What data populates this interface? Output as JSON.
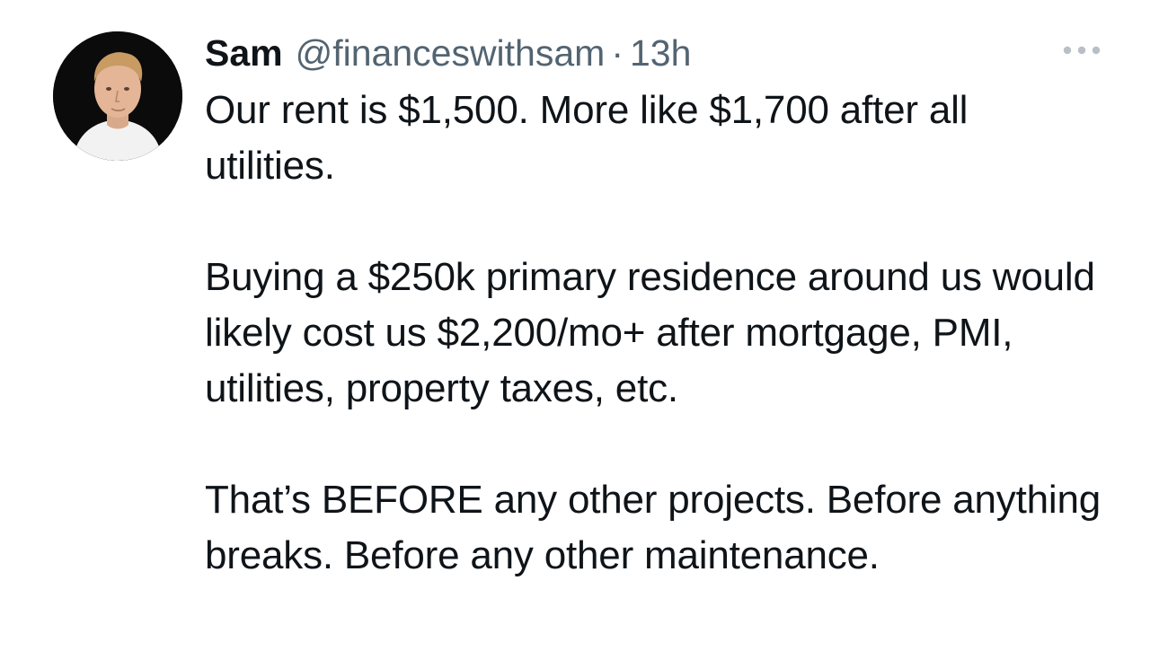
{
  "tweet": {
    "author": {
      "display_name": "Sam",
      "handle": "@financeswithsam",
      "avatar_icon": "profile-photo"
    },
    "separator": "·",
    "timestamp": "13h",
    "more_icon": "more-options-icon",
    "paragraphs": [
      "Our rent is $1,500. More like $1,700 after all utilities.",
      "Buying a $250k primary residence around us would likely cost us $2,200/mo+ after mortgage, PMI, utilities, property taxes, etc.",
      "That’s BEFORE any other projects. Before anything breaks. Before any other maintenance."
    ]
  },
  "colors": {
    "text_primary": "#0f1419",
    "text_secondary": "#536471",
    "background": "#ffffff",
    "avatar_bg": "#0b0b0b"
  }
}
